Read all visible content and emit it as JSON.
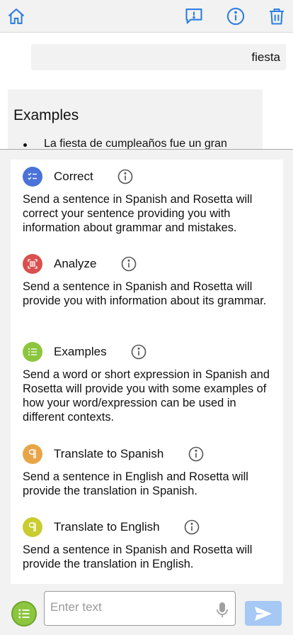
{
  "colors": {
    "accent_blue": "#2f7fe0",
    "correct_icon": "#4a72d9",
    "analyze_icon": "#d9504e",
    "examples_icon": "#8cc63f",
    "translate_es_icon": "#e8a548",
    "translate_en_icon": "#c9cc2f",
    "send_button": "#a5c8f5"
  },
  "topbar": {
    "home_icon": "home-icon",
    "feedback_icon": "feedback-icon",
    "info_icon": "info-icon",
    "trash_icon": "trash-icon"
  },
  "chat": {
    "user_message": "fiesta",
    "bot_heading": "Examples",
    "bot_items": [
      "La fiesta de cumpleaños fue un gran"
    ]
  },
  "modes": [
    {
      "title": "Correct",
      "icon": "checklist-icon",
      "description": "Send a sentence in Spanish and Rosetta will correct your sentence providing you with information about grammar and mistakes."
    },
    {
      "title": "Analyze",
      "icon": "analyze-icon",
      "description": "Send a sentence in Spanish and Rosetta will provide you with information about its grammar."
    },
    {
      "title": "Examples",
      "icon": "list-icon",
      "description": "Send a word or short expression in Spanish and Rosetta will provide you with some examples of how your word/expression can be used in different contexts."
    },
    {
      "title": "Translate to Spanish",
      "icon": "paragraph-icon",
      "description": "Send a sentence in English and Rosetta will provide the translation in Spanish."
    },
    {
      "title": "Translate to English",
      "icon": "paragraph-icon",
      "description": "Send a sentence in Spanish and Rosetta will provide the translation in English."
    }
  ],
  "composer": {
    "placeholder": "Enter text",
    "value": "",
    "mic_icon": "microphone-icon",
    "send_icon": "send-icon",
    "menu_icon": "list-icon"
  }
}
